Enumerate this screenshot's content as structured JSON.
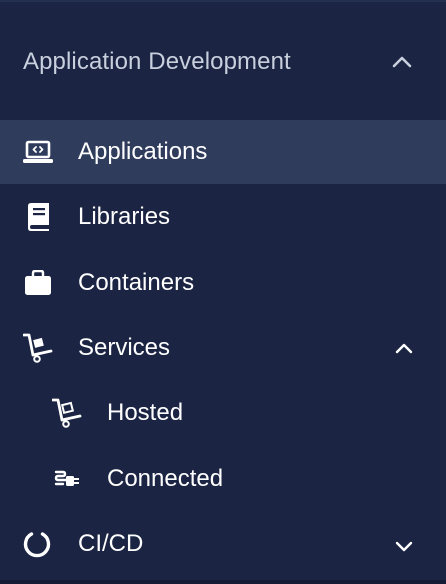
{
  "section": {
    "title": "Application Development",
    "expanded": true
  },
  "nav": {
    "applications": {
      "label": "Applications",
      "icon": "laptop-code-icon",
      "active": true
    },
    "libraries": {
      "label": "Libraries",
      "icon": "book-icon"
    },
    "containers": {
      "label": "Containers",
      "icon": "briefcase-icon"
    },
    "services": {
      "label": "Services",
      "icon": "hand-cart-icon",
      "expanded": true,
      "children": {
        "hosted": {
          "label": "Hosted",
          "icon": "hand-cart-icon"
        },
        "connected": {
          "label": "Connected",
          "icon": "plug-icon"
        }
      }
    },
    "cicd": {
      "label": "CI/CD",
      "icon": "ring-icon",
      "expanded": false
    }
  },
  "colors": {
    "background": "#1b2443",
    "active_row": "#2f3c5c",
    "header_text": "#c8cfdd",
    "item_text": "#ffffff"
  }
}
